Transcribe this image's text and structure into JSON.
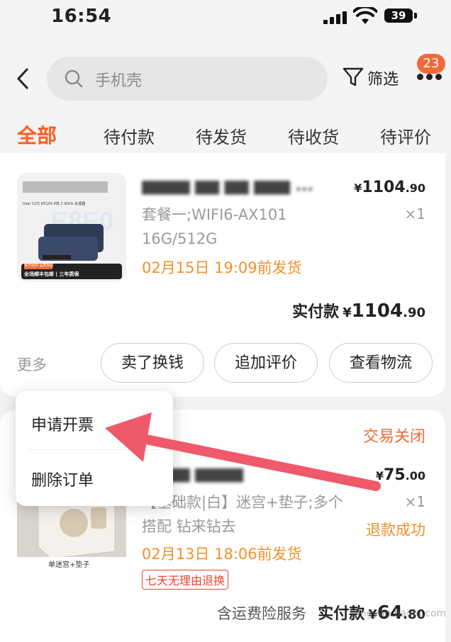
{
  "status_bar": {
    "time": "16:54",
    "battery": "39"
  },
  "header": {
    "search_placeholder": "手机壳",
    "filter_label": "筛选",
    "badge_count": "23"
  },
  "tabs": [
    {
      "label": "全部",
      "active": true
    },
    {
      "label": "待付款"
    },
    {
      "label": "待发货"
    },
    {
      "label": "待收货"
    },
    {
      "label": "待评价"
    }
  ],
  "orders": [
    {
      "thumb_texts": [
        "Intel 11代 N5105 4核 2.9GHz 处理器",
        "官方授权 品质保证",
        "全场顺丰包邮 | 三年质保"
      ],
      "title": "▆▆▆▆ ▆▆ ▆▆ ▆▆▆ ...",
      "price_yen": "¥",
      "price_int": "1104",
      "price_dec": ".90",
      "spec": "套餐一;WIFI6-AX101 16G/512G",
      "qty": "×1",
      "ship": "02月15日 19:09前发货",
      "paid_label": "实付款",
      "paid_yen": "¥",
      "paid_int": "1104",
      "paid_dec": ".90",
      "more": "更多",
      "actions": [
        "卖了换钱",
        "追加评价",
        "查看物流"
      ]
    },
    {
      "status": "交易关闭",
      "thumb_caption": "单迷宫+垫子",
      "title": "▆▆▆▆ ▆▆▆▆",
      "price_yen": "¥",
      "price_int": "75",
      "price_dec": ".00",
      "spec": "【基础款|白】迷宫+垫子;多个搭配 钻来钻去",
      "qty": "×1",
      "refund": "退款成功",
      "ship": "02月13日 18:06前发货",
      "tag": "七天无理由退换",
      "insurance": "含运费险服务",
      "paid_label": "实付款",
      "paid_yen": "¥",
      "paid_int": "64",
      "paid_dec": ".80"
    }
  ],
  "popup": {
    "items": [
      "申请开票",
      "删除订单"
    ]
  },
  "colors": {
    "accent": "#ff5b1f",
    "ship": "#f0912b",
    "arrow": "#ef5a6a"
  },
  "watermark": "jingyan.baidu.com"
}
